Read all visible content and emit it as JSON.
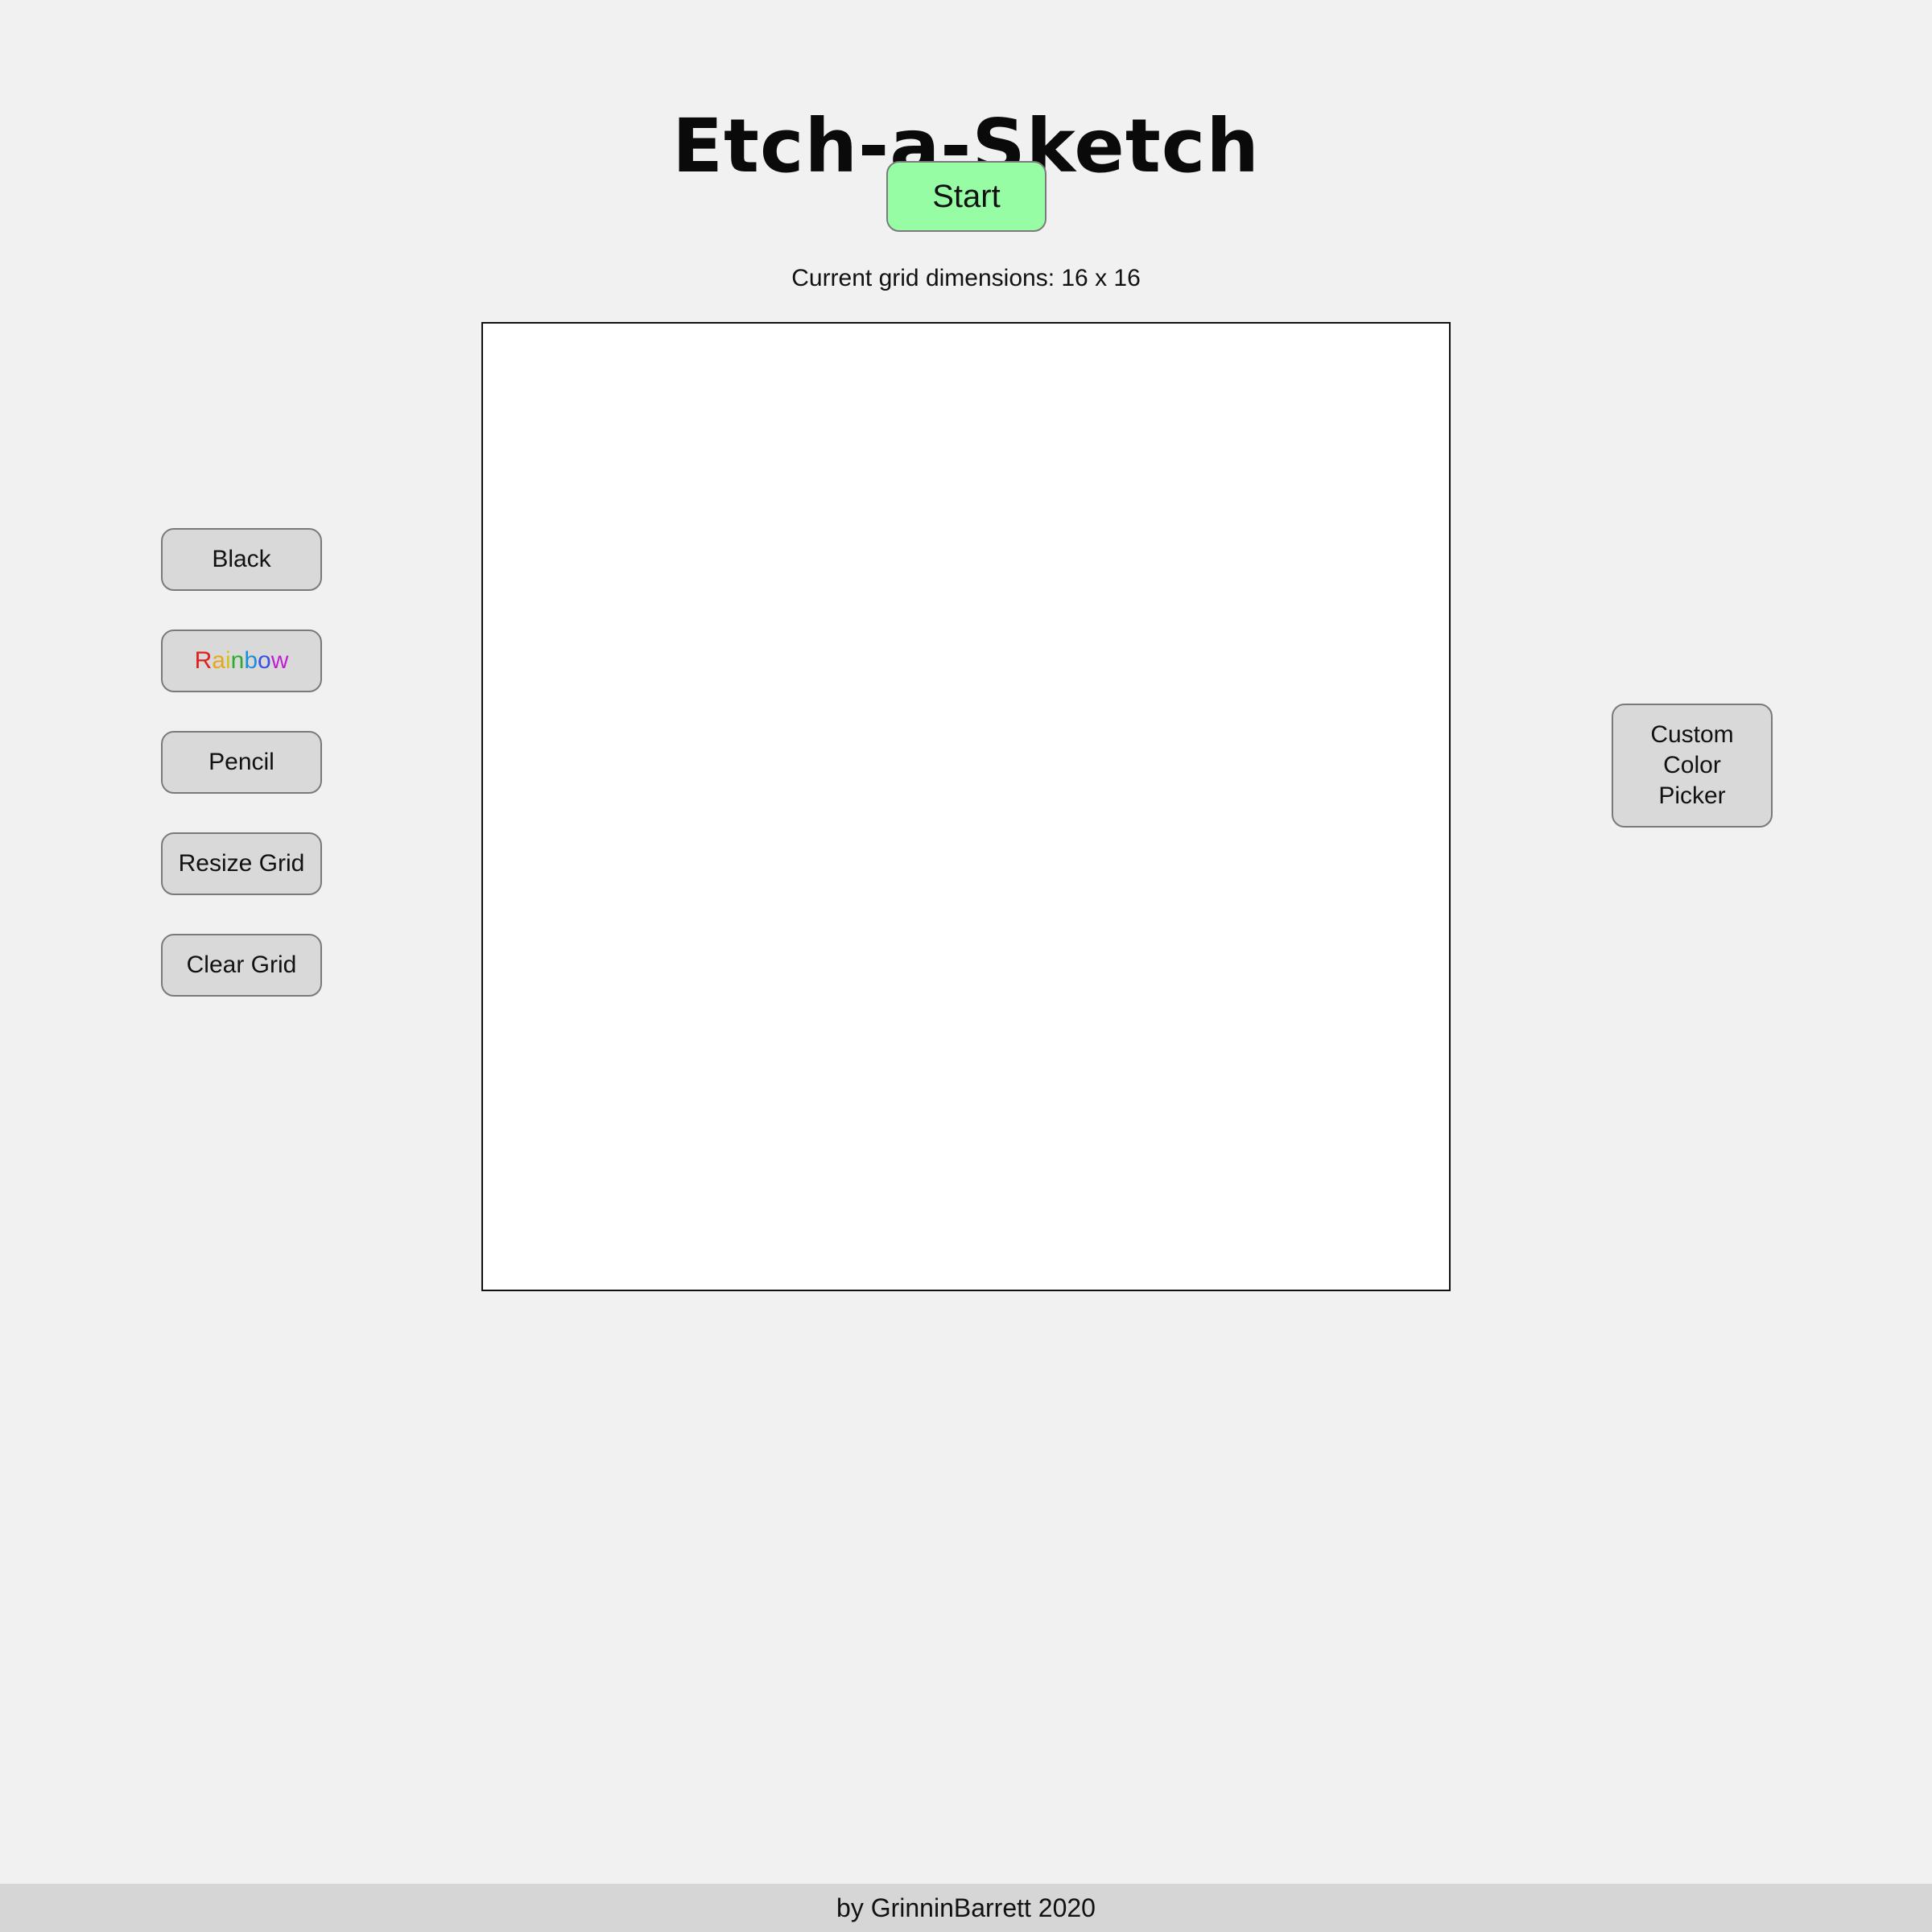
{
  "header": {
    "title": "Etch-a-Sketch",
    "start_label": "Start",
    "start_color": "#97fda4"
  },
  "status": {
    "grid_dimensions_text": "Current grid dimensions: 16 x 16"
  },
  "toolbar": {
    "black_label": "Black",
    "rainbow_letters": [
      {
        "char": "R",
        "color": "#e0201d"
      },
      {
        "char": "a",
        "color": "#e8a61a"
      },
      {
        "char": "i",
        "color": "#d6c21a"
      },
      {
        "char": "n",
        "color": "#2eab2e"
      },
      {
        "char": "b",
        "color": "#1f8fd6"
      },
      {
        "char": "o",
        "color": "#3b4fe0"
      },
      {
        "char": "w",
        "color": "#c21fd1"
      }
    ],
    "pencil_label": "Pencil",
    "resize_label": "Resize Grid",
    "clear_label": "Clear Grid"
  },
  "custom_picker": {
    "label": "Custom\nColor\nPicker"
  },
  "grid": {
    "background": "#ffffff"
  },
  "footer": {
    "text": "by GrinninBarrett 2020"
  }
}
